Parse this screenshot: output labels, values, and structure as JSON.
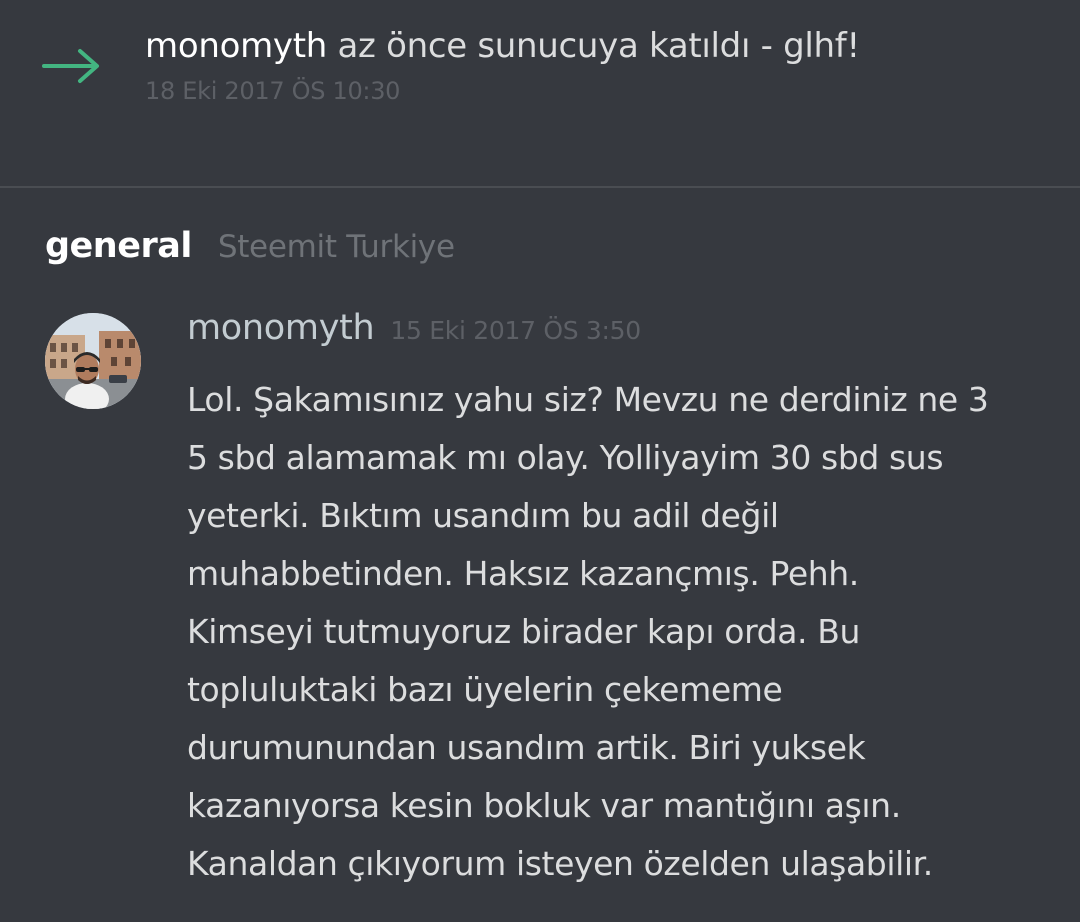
{
  "system_message": {
    "username": "monomyth",
    "text": " az önce sunucuya katıldı - glhf!",
    "timestamp": "18 Eki 2017 ÖS 10:30",
    "icon": "join-arrow-icon",
    "icon_color": "#43b581"
  },
  "channel": {
    "name": "general",
    "server": "Steemit Turkiye"
  },
  "message": {
    "author": "monomyth",
    "timestamp": "15 Eki 2017 ÖS 3:50",
    "lines": [
      "Lol. Şakamısınız yahu siz? Mevzu ne derdiniz ne 3",
      "5 sbd alamamak mı olay. Yolliyayim 30 sbd sus",
      "yeterki. Bıktım usandım bu adil değil",
      "muhabbetinden. Haksız kazançmış. Pehh.",
      "Kimseyi tutmuyoruz birader kapı orda. Bu",
      "topluluktaki bazı üyelerin çekememe",
      "durumunundan usandım artik. Biri yuksek",
      "kazanıyorsa kesin bokluk var mantığını aşın.",
      "Kanaldan çıkıyorum isteyen özelden ulaşabilir."
    ]
  },
  "colors": {
    "background": "#36393f",
    "divider": "#4a4d52",
    "text": "#dcddde",
    "muted": "#5d6066",
    "author": "#c3ccd1"
  }
}
